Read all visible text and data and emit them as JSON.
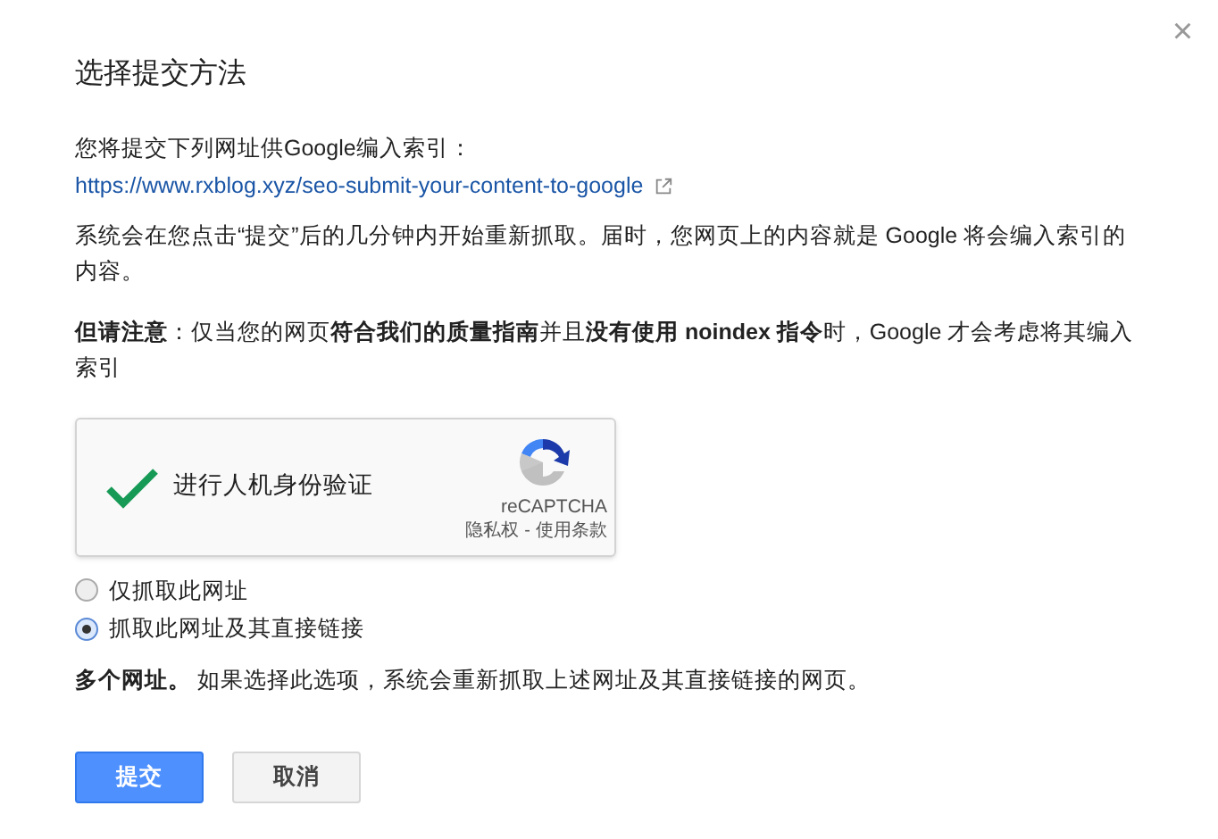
{
  "dialog": {
    "title": "选择提交方法",
    "close": "×"
  },
  "intro": "您将提交下列网址供Google编入索引：",
  "url": "https://www.rxblog.xyz/seo-submit-your-content-to-google",
  "info": "系统会在您点击“提交”后的几分钟内开始重新抓取。届时，您网页上的内容就是 Google 将会编入索引的内容。",
  "note": "**但请注意**：仅当您的网页**符合我们的质量指南**并且**没有使用 noindex 指令**时，Google 才会考虑将其编入索引",
  "captcha": {
    "label": "进行人机身份验证",
    "verified": true,
    "brand": "reCAPTCHA",
    "privacy": "隐私权",
    "separator": "-",
    "terms": "使用条款"
  },
  "options": [
    {
      "label": "仅抓取此网址",
      "selected": false
    },
    {
      "label": "抓取此网址及其直接链接",
      "selected": true
    }
  ],
  "description": "**多个网址。** 如果选择此选项，系统会重新抓取上述网址及其直接链接的网页。",
  "buttons": [
    {
      "label": "提交",
      "kind": "primary"
    },
    {
      "label": "取消",
      "kind": "secondary"
    }
  ]
}
